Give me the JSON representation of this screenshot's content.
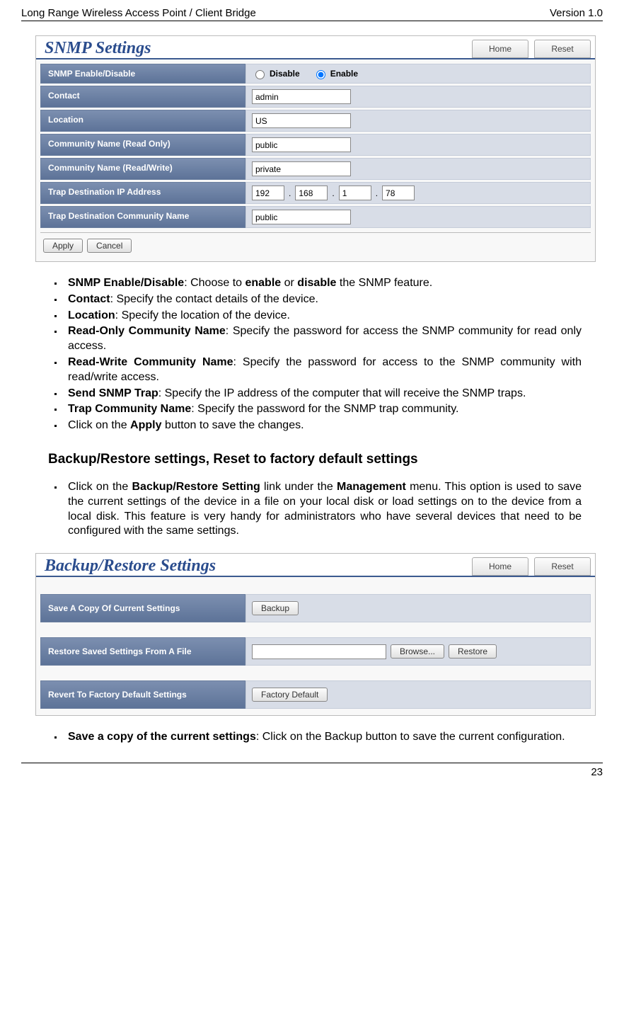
{
  "header": {
    "left": "Long Range Wireless Access Point / Client Bridge",
    "right": "Version 1.0"
  },
  "footer": {
    "page": "23"
  },
  "snmp_panel": {
    "title": "SNMP Settings",
    "btn_home": "Home",
    "btn_reset": "Reset",
    "rows": {
      "enable_label": "SNMP Enable/Disable",
      "disable_opt": "Disable",
      "enable_opt": "Enable",
      "contact_label": "Contact",
      "contact_val": "admin",
      "location_label": "Location",
      "location_val": "US",
      "comm_ro_label": "Community Name (Read Only)",
      "comm_ro_val": "public",
      "comm_rw_label": "Community Name (Read/Write)",
      "comm_rw_val": "private",
      "trap_ip_label": "Trap Destination IP Address",
      "ip1": "192",
      "ip2": "168",
      "ip3": "1",
      "ip4": "78",
      "trap_comm_label": "Trap Destination Community Name",
      "trap_comm_val": "public"
    },
    "btn_apply": "Apply",
    "btn_cancel": "Cancel"
  },
  "snmp_bullets": {
    "b1_bold": "SNMP Enable/Disable",
    "b1_rest_a": ": Choose to ",
    "b1_bold_a": "enable",
    "b1_mid": " or ",
    "b1_bold_b": "disable",
    "b1_rest_b": " the SNMP feature.",
    "b2_bold": "Contact",
    "b2_rest": ": Specify the contact details of the device.",
    "b3_bold": "Location",
    "b3_rest": ": Specify the location of the device.",
    "b4_bold": "Read-Only Community Name",
    "b4_rest": ": Specify the password for access the SNMP community for read only access.",
    "b5_bold": "Read-Write Community Name",
    "b5_rest": ": Specify the password for access to the SNMP community with read/write access.",
    "b6_bold": "Send SNMP Trap",
    "b6_rest": ": Specify the IP address of the computer that will receive the SNMP traps.",
    "b7_bold": "Trap Community Name",
    "b7_rest": ": Specify the password for the SNMP trap community.",
    "b8_pre": "Click on the ",
    "b8_bold": "Apply",
    "b8_post": " button to save the changes."
  },
  "backup_section_title": "Backup/Restore settings, Reset to factory default settings",
  "backup_intro": {
    "pre": "Click on the ",
    "bold1": "Backup/Restore Setting",
    "mid1": " link under the ",
    "bold2": "Management",
    "post": " menu. This option is used to save the current settings of the device in a file on your local disk or load settings on to the device from a local disk. This feature is very handy for administrators who have several devices that need to be configured with the same settings."
  },
  "backup_panel": {
    "title": "Backup/Restore Settings",
    "btn_home": "Home",
    "btn_reset": "Reset",
    "save_label": "Save A Copy Of Current Settings",
    "btn_backup": "Backup",
    "restore_label": "Restore Saved Settings From A File",
    "btn_browse": "Browse...",
    "btn_restore": "Restore",
    "revert_label": "Revert To Factory Default Settings",
    "btn_factory": "Factory Default"
  },
  "last_bullet": {
    "bold": "Save a copy of the current settings",
    "rest": ": Click on the Backup button to save the current configuration."
  }
}
